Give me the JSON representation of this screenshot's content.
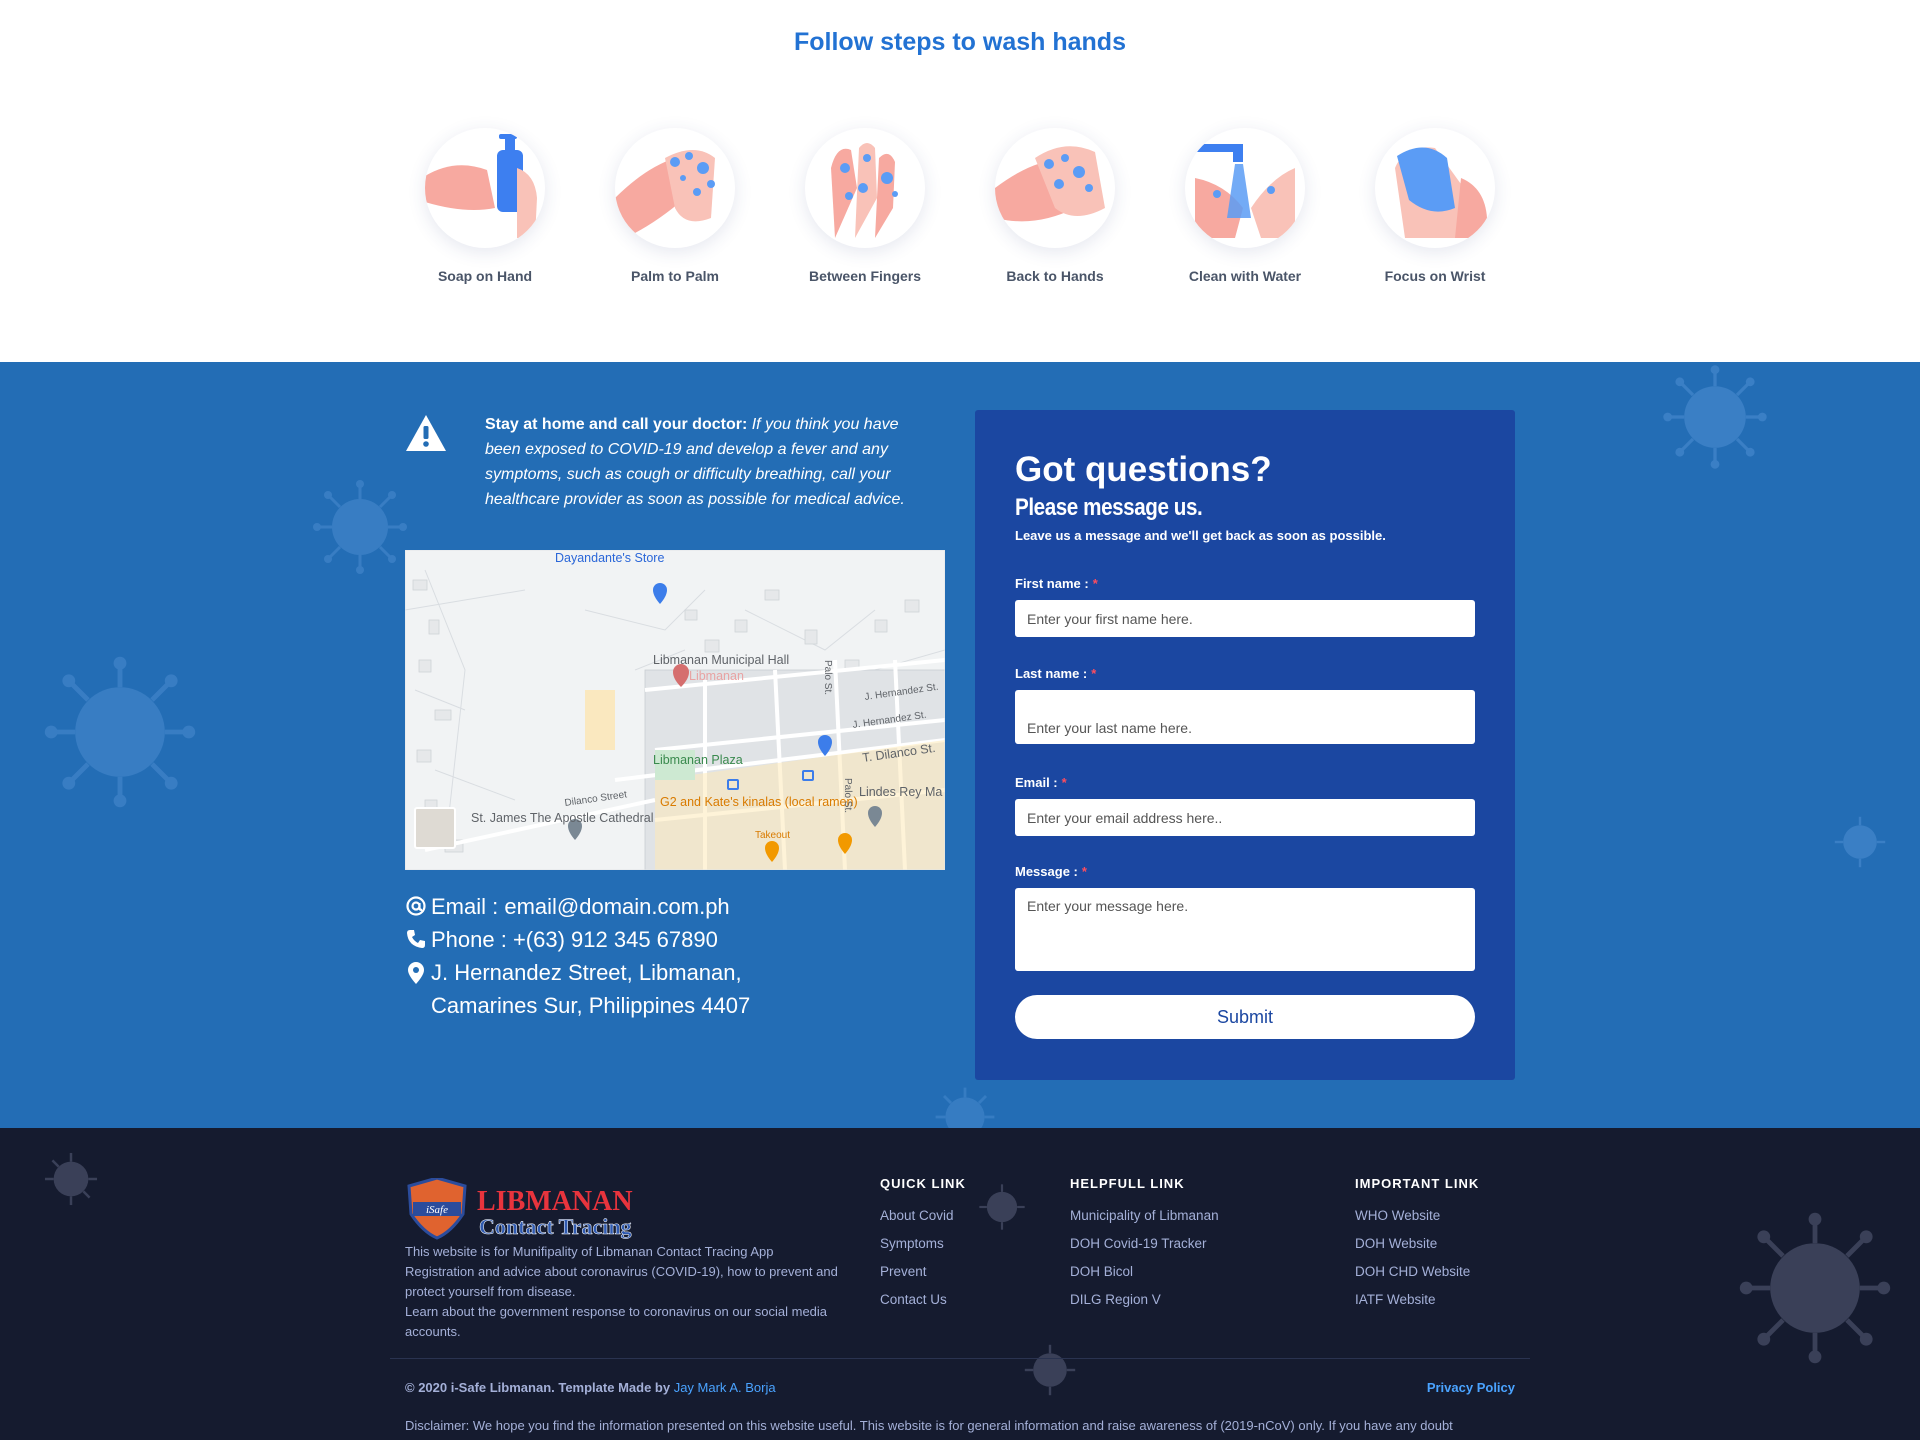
{
  "wash": {
    "title": "Follow steps to wash hands",
    "steps": [
      {
        "label": "Soap on Hand",
        "icon": "soap-on-hand-icon"
      },
      {
        "label": "Palm to Palm",
        "icon": "palm-to-palm-icon"
      },
      {
        "label": "Between Fingers",
        "icon": "between-fingers-icon"
      },
      {
        "label": "Back to Hands",
        "icon": "back-to-hands-icon"
      },
      {
        "label": "Clean with Water",
        "icon": "clean-with-water-icon"
      },
      {
        "label": "Focus on Wrist",
        "icon": "focus-on-wrist-icon"
      }
    ]
  },
  "alert": {
    "icon": "warning-icon",
    "bold": "Stay at home and call your doctor:",
    "text": " If you think you have been exposed to COVID-19 and develop a fever and any symptoms, such as cough or difficulty breathing, call your healthcare provider as soon as possible for medical advice."
  },
  "map": {
    "labels": {
      "store": "Dayandante's Store",
      "hall": "Libmanan Municipal Hall",
      "hall_faded": "Libmanan",
      "plaza": "Libmanan Plaza",
      "hernandez1": "J. Hernandez St.",
      "hernandez2": "J. Hernandez St.",
      "dilanco": "T. Dilanco St.",
      "dilanco_street": "Dilanco Street",
      "lindes": "Lindes Rey Ma",
      "cathedral": "St. James The Apostle Cathedral",
      "ramen": "G2 and Kate's kinalas (local ramen)",
      "takeout": "Takeout",
      "palo1": "Palo St.",
      "palo2": "Palo St."
    }
  },
  "contact_info": {
    "email": "Email : email@domain.com.ph",
    "phone": "Phone : +(63) 912 345 67890",
    "address": "J. Hernandez Street, Libmanan, Camarines Sur, Philippines 4407"
  },
  "form": {
    "title": "Got questions?",
    "subtitle": "Please message us.",
    "note": "Leave us a message and we'll get back as soon as possible.",
    "first_name_label": "First name :",
    "first_name_placeholder": "Enter your first name here.",
    "last_name_label": "Last name :",
    "last_name_placeholder": "Enter your last name here.",
    "email_label": "Email :",
    "email_placeholder": "Enter your email address here..",
    "message_label": "Message :",
    "message_placeholder": "Enter your message here.",
    "required_mark": "*",
    "submit": "Submit"
  },
  "footer": {
    "logo_line1": "LIBMANAN",
    "logo_line2": "Contact Tracing",
    "logo_badge": "iSafe",
    "description": "This website is for Munifipality of Libmanan Contact Tracing App Registration and advice about coronavirus (COVID-19), how to prevent and protect yourself from disease.",
    "description2": "Learn about the government response to coronavirus on our social media accounts.",
    "quick": {
      "title": "QUICK LINK",
      "links": [
        "About Covid",
        "Symptoms",
        "Prevent",
        "Contact Us"
      ]
    },
    "helpful": {
      "title": "HELPFULL LINK",
      "links": [
        "Municipality of Libmanan",
        "DOH Covid-19 Tracker",
        "DOH Bicol",
        "DILG Region V"
      ]
    },
    "important": {
      "title": "IMPORTANT LINK",
      "links": [
        "WHO Website",
        "DOH Website",
        "DOH CHD Website",
        "IATF Website"
      ]
    },
    "copyright": "© 2020 i-Safe Libmanan. Template Made by ",
    "author": "Jay Mark A. Borja",
    "privacy": "Privacy Policy",
    "disclaimer": "Disclaimer: We hope you find the information presented on this website useful. This website is for general information and raise awareness of (2019-nCoV) only. If you have any doubt"
  }
}
